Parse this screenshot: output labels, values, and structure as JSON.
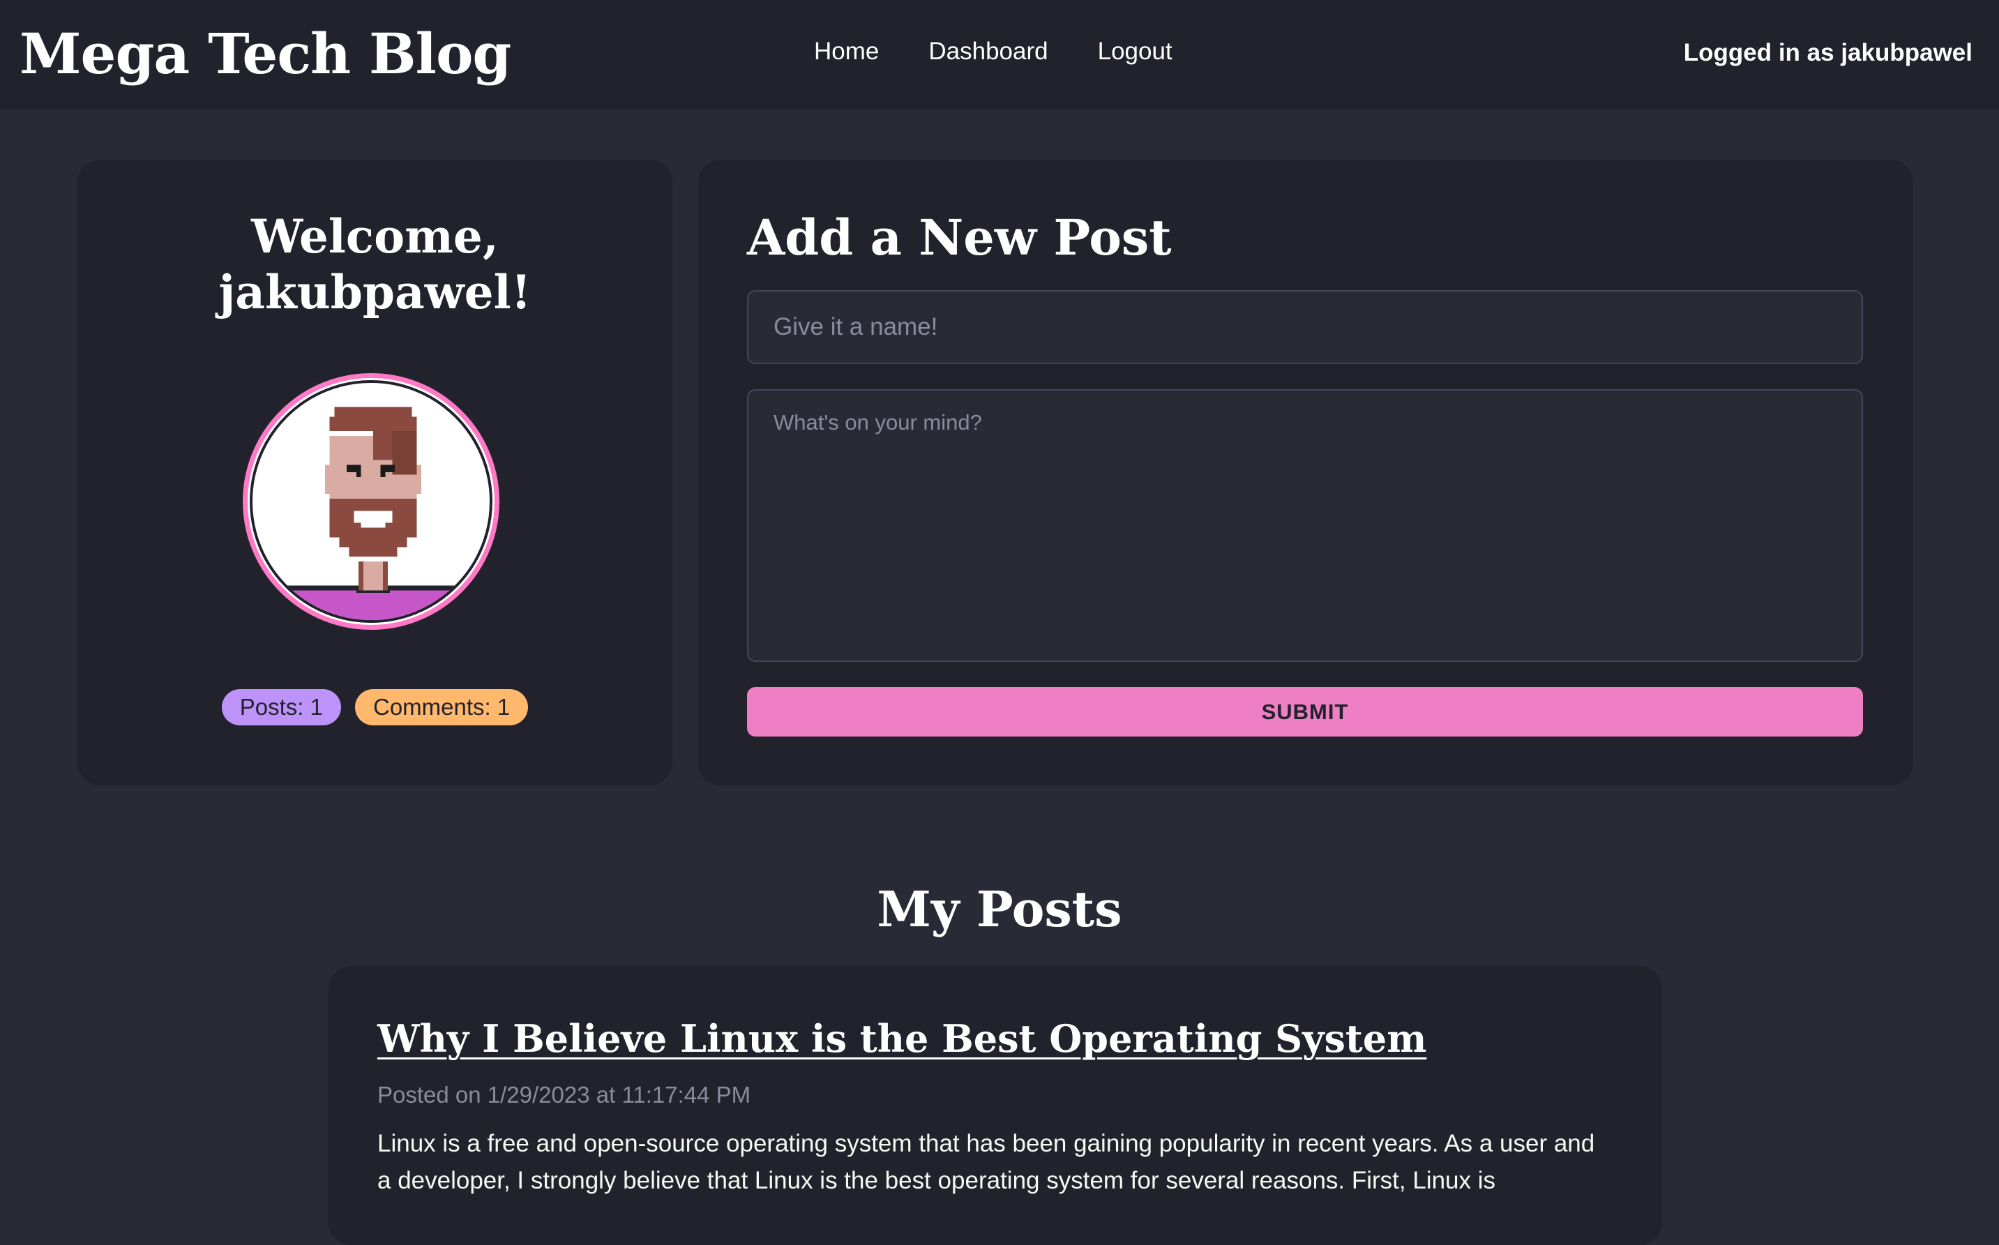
{
  "header": {
    "brand": "Mega Tech Blog",
    "nav": [
      "Home",
      "Dashboard",
      "Logout"
    ],
    "logged_in_text": "Logged in as jakubpawel"
  },
  "profile": {
    "welcome_line1": "Welcome,",
    "welcome_line2": "jakubpawel!",
    "posts_badge": "Posts: 1",
    "comments_badge": "Comments: 1",
    "avatar_icon": "pixel-avatar-icon"
  },
  "new_post": {
    "title": "Add a New Post",
    "title_placeholder": "Give it a name!",
    "body_placeholder": "What's on your mind?",
    "submit_label": "SUBMIT"
  },
  "my_posts": {
    "section_title": "My Posts",
    "posts": [
      {
        "title": "Why I Believe Linux is the Best Operating System",
        "meta": "Posted on 1/29/2023 at 11:17:44 PM",
        "body": "Linux is a free and open-source operating system that has been gaining popularity in recent years. As a user and a developer, I strongly believe that Linux is the best operating system for several reasons. First, Linux is"
      }
    ]
  },
  "colors": {
    "background": "#282a36",
    "card": "#21222c",
    "accent_pink": "#ff79c6",
    "badge_purple": "#bd93f9",
    "badge_orange": "#ffb86c"
  }
}
